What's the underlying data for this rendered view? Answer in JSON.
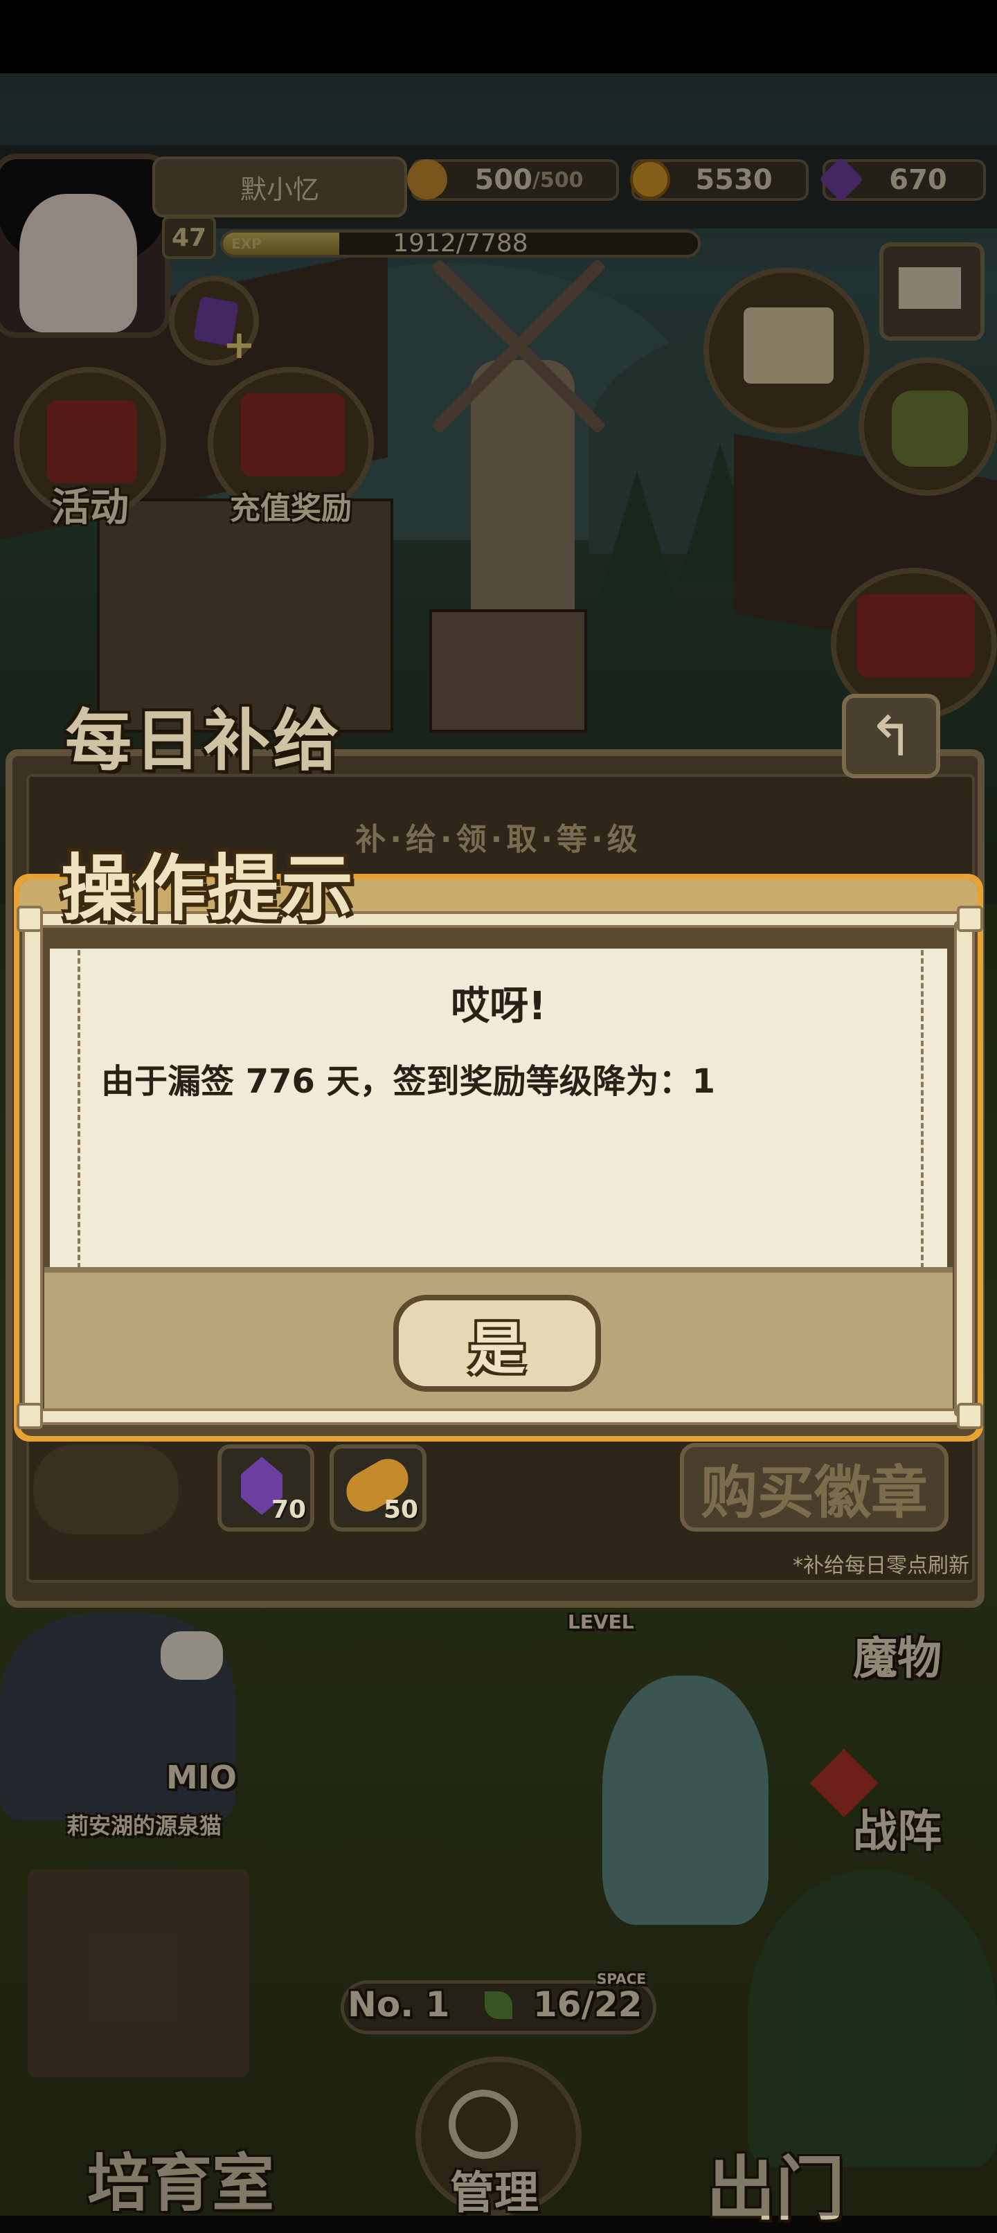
{
  "player": {
    "name": "默小忆",
    "level": "47",
    "exp_label": "EXP",
    "exp_text": "1912/7788",
    "exp_fraction": 0.245
  },
  "currencies": {
    "stamina_current": "500",
    "stamina_max": "/500",
    "gold": "5530",
    "gems": "670"
  },
  "events": {
    "activity_label": "活动",
    "recharge_label": "充值奖励",
    "chest_label": "每日补给"
  },
  "daily_supply": {
    "title": "每日补给",
    "subtitle": "补·给·领·取·等·级",
    "back_icon": "↰",
    "items": [
      {
        "icon": "gem-icon",
        "qty": "70"
      },
      {
        "icon": "bread-icon",
        "qty": "50"
      }
    ],
    "buy_badge_label": "购买徽章",
    "refresh_note": "*补给每日零点刷新"
  },
  "dialog": {
    "title": "操作提示",
    "heading": "哎呀!",
    "message": "由于漏签 776 天，签到奖励等级降为：1",
    "confirm_label": "是"
  },
  "scene": {
    "companion_name": "MIO",
    "companion_title": "莉安湖的源泉猫",
    "level_tag": "LEVEL",
    "monster_label": "魔物",
    "battle_label": "战阵",
    "rank_label": "No. 1",
    "space_tag": "SPACE",
    "capacity": "16/22",
    "nursery_label": "培育室",
    "manage_label": "管理",
    "exit_label": "出门"
  },
  "colors": {
    "dialog_border": "#e6a233",
    "dialog_paper": "#f1ead6",
    "text_dark": "#2a2016"
  }
}
